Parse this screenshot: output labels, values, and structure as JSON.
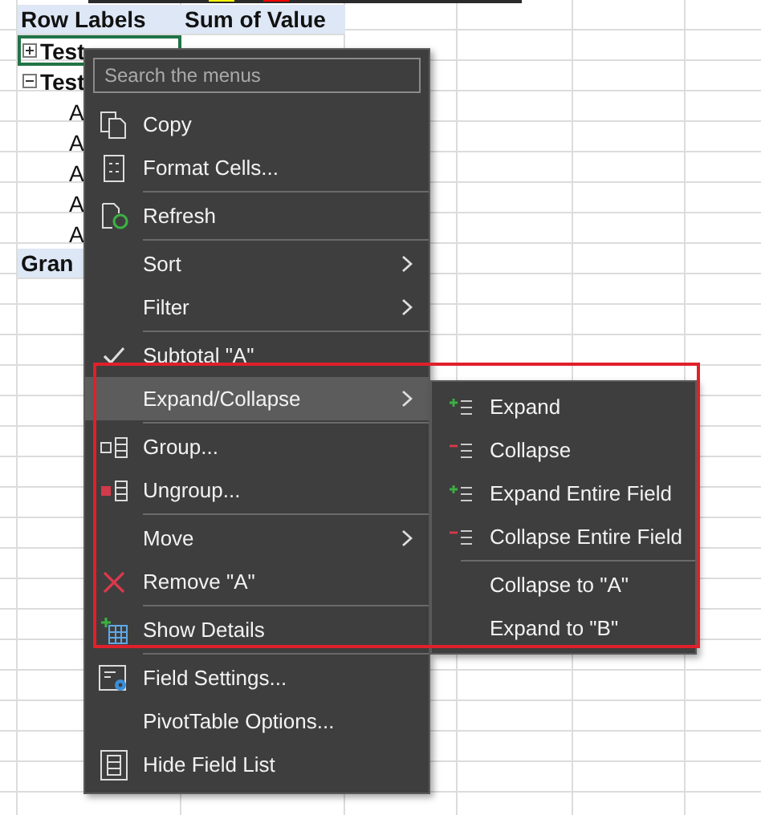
{
  "sheet": {
    "header": [
      "Row Labels",
      "Sum of Value"
    ],
    "rows": [
      {
        "kind": "group",
        "label": "Test",
        "expanded": false,
        "selected": true
      },
      {
        "kind": "group",
        "label": "Test",
        "expanded": true,
        "selected": false
      },
      {
        "kind": "item",
        "label": "A",
        "selected": false
      },
      {
        "kind": "item",
        "label": "A",
        "selected": false
      },
      {
        "kind": "item",
        "label": "A",
        "selected": false
      },
      {
        "kind": "item",
        "label": "A",
        "selected": false
      },
      {
        "kind": "item",
        "label": "A",
        "selected": false
      },
      {
        "kind": "total",
        "label": "Gran",
        "selected": false
      }
    ]
  },
  "context_menu": {
    "search": {
      "placeholder": "Search the menus"
    },
    "items": [
      {
        "kind": "item",
        "label": "Copy",
        "checked": false,
        "submenu": false,
        "selected": false
      },
      {
        "kind": "item",
        "label": "Format Cells...",
        "checked": false,
        "submenu": false,
        "selected": false
      },
      {
        "kind": "separator"
      },
      {
        "kind": "item",
        "label": "Refresh",
        "checked": false,
        "submenu": false,
        "selected": false
      },
      {
        "kind": "separator"
      },
      {
        "kind": "item",
        "label": "Sort",
        "checked": false,
        "submenu": true,
        "selected": false
      },
      {
        "kind": "item",
        "label": "Filter",
        "checked": false,
        "submenu": true,
        "selected": false
      },
      {
        "kind": "separator"
      },
      {
        "kind": "item",
        "label": "Subtotal \"A\"",
        "checked": true,
        "submenu": false,
        "selected": false
      },
      {
        "kind": "item",
        "label": "Expand/Collapse",
        "checked": false,
        "submenu": true,
        "selected": true
      },
      {
        "kind": "separator"
      },
      {
        "kind": "item",
        "label": "Group...",
        "checked": false,
        "submenu": false,
        "selected": false
      },
      {
        "kind": "item",
        "label": "Ungroup...",
        "checked": false,
        "submenu": false,
        "selected": false
      },
      {
        "kind": "separator"
      },
      {
        "kind": "item",
        "label": "Move",
        "checked": false,
        "submenu": true,
        "selected": false
      },
      {
        "kind": "item",
        "label": "Remove \"A\"",
        "checked": false,
        "submenu": false,
        "selected": false
      },
      {
        "kind": "separator"
      },
      {
        "kind": "item",
        "label": "Show Details",
        "checked": false,
        "submenu": false,
        "selected": false
      },
      {
        "kind": "separator"
      },
      {
        "kind": "item",
        "label": "Field Settings...",
        "checked": false,
        "submenu": false,
        "selected": false
      },
      {
        "kind": "item",
        "label": "PivotTable Options...",
        "checked": false,
        "submenu": false,
        "selected": false
      },
      {
        "kind": "item",
        "label": "Hide Field List",
        "checked": false,
        "submenu": false,
        "selected": false
      }
    ]
  },
  "submenu": {
    "items": [
      {
        "kind": "item",
        "label": "Expand",
        "selected": false
      },
      {
        "kind": "item",
        "label": "Collapse",
        "selected": false
      },
      {
        "kind": "item",
        "label": "Expand Entire Field",
        "selected": false
      },
      {
        "kind": "item",
        "label": "Collapse Entire Field",
        "selected": false
      },
      {
        "kind": "separator"
      },
      {
        "kind": "item",
        "label": "Collapse to \"A\"",
        "selected": false
      },
      {
        "kind": "item",
        "label": "Expand to \"B\"",
        "selected": false
      }
    ]
  }
}
